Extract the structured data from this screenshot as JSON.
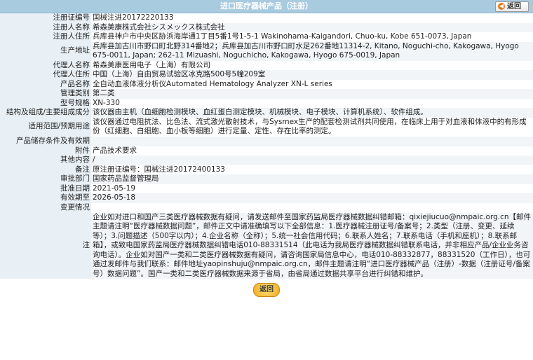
{
  "header": {
    "title": "进口医疗器械产品（注册）",
    "back_label": "返回"
  },
  "rows": [
    {
      "label": "注册证编号",
      "value": "国械注进20172220133"
    },
    {
      "label": "注册人名称",
      "value": "希森美康株式会社シスメックス株式会社"
    },
    {
      "label": "注册人住所",
      "value": "兵库县神户市中央区胁浜海岸通1丁目5番1号1-5-1 Wakinohama-Kaigandori, Chuo-ku, Kobe 651-0073, Japan"
    },
    {
      "label": "生产地址",
      "value": "兵库县加古川市野口町北野314番地2；兵库县加古川市野口町水足262番地11314-2, Kitano, Noguchi-cho, Kakogawa, Hyogo 675-0011, Japan; 262-11 Mizuashi, Noguchicho, Kakogawa, Hyogo 675-0019, Japan"
    },
    {
      "label": "代理人名称",
      "value": "希森美康医用电子（上海）有限公司"
    },
    {
      "label": "代理人住所",
      "value": "中国（上海）自由贸易试验区冰克路500号5幢209室"
    },
    {
      "label": "产品名称",
      "value": "全自动血液体液分析仪Automated Hematology Analyzer XN-L series"
    },
    {
      "label": "管理类别",
      "value": "第二类"
    },
    {
      "label": "型号规格",
      "value": "XN-330"
    },
    {
      "label": "结构及组成/主要组成成分",
      "value": "该仪器由主机（血细胞检测模块、血红蛋白测定模块、机械模块、电子模块、计算机系统）、软件组成。"
    },
    {
      "label": "适用范围/预期用途",
      "value": "该仪器通过电阻抗法、比色法、流式激光散射技术，与Sysmex生产的配套检测试剂共同使用，在临床上用于对血液和体液中的有形成份（红细胞、白细胞、血小板等细胞）进行定量、定性、存在比率的测定。"
    },
    {
      "label": "产品储存条件及有效期",
      "value": ""
    },
    {
      "label": "附件",
      "value": "产品技术要求"
    },
    {
      "label": "其他内容",
      "value": "/"
    },
    {
      "label": "备注",
      "value": "原注册证编号：国械注进20172400133"
    },
    {
      "label": "审批部门",
      "value": "国家药品监督管理局"
    },
    {
      "label": "批准日期",
      "value": "2021-05-19"
    },
    {
      "label": "有效期至",
      "value": "2026-05-18"
    },
    {
      "label": "变更情况",
      "value": ""
    },
    {
      "label": "注",
      "value": "企业如对进口和国产三类医疗器械数据有疑问，请发送邮件至国家药监局医疗器械数据纠错邮箱：qixiejiucuo@nmpaic.org.cn【邮件主题请注明“医疗器械数据问题”，邮件正文中请准确填写以下全部信息：1.医疗器械注册证号/备案号；2.类型（注册、变更、延续等）；3.问题描述（500字以内）；4.企业名称（全称）；5.统一社会信用代码；6.联系人姓名；7.联系电话（手机和座机）；8.联系邮箱】，或致电国家药监局医疗器械数据纠错电话010-88331514（此电话为我局医疗器械数据纠错联系电话，并非相应产品/企业业务咨询电话）。企业如对国产一类和二类医疗器械数据有疑问，请咨询国家局信息中心，电话010-88332877，88331520（工作日），也可通过发邮件与我们联系：邮件地址yaopinshuju@nmpaic.org.cn，邮件主题请注明“进口医疗器械产品（注册）-数据（注册证号/备案号）数据问题”。国产一类和二类医疗器械数据来源于省局，由省局通过数据共享平台进行纠错和维护。"
    }
  ],
  "footer": {
    "back_label": "返回"
  }
}
